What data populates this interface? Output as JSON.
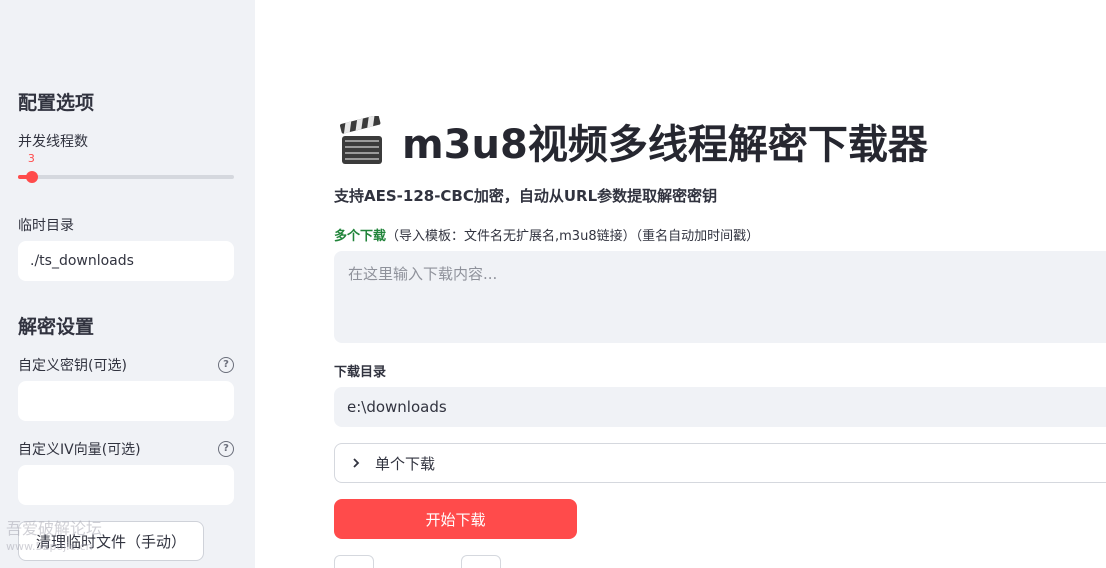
{
  "sidebar": {
    "config_heading": "配置选项",
    "threads_label": "并发线程数",
    "threads_value": "3",
    "threads_min": 1,
    "threads_max": 32,
    "tempdir_label": "临时目录",
    "tempdir_value": "./ts_downloads",
    "decrypt_heading": "解密设置",
    "key_label": "自定义密钥(可选)",
    "key_value": "",
    "iv_label": "自定义IV向量(可选)",
    "iv_value": "",
    "help_glyph": "?",
    "clean_button": "清理临时文件（手动）",
    "watermark_line1": "吾爱破解论坛",
    "watermark_line2": "www.52pojie.cn"
  },
  "main": {
    "title": "m3u8视频多线程解密下载器",
    "title_icon": "clapper-board-icon",
    "subtitle": "支持AES-128-CBC加密，自动从URL参数提取解密密钥",
    "multi_label_strong": "多个下载",
    "multi_label_rest": "（导入模板：文件名无扩展名,m3u8链接）（重名自动加时间戳）",
    "multi_placeholder": "在这里输入下载内容...",
    "download_dir_label": "下载目录",
    "download_dir_value": "e:\\downloads",
    "single_expander": "单个下载",
    "start_button": "开始下载"
  },
  "colors": {
    "accent": "#ff4b4b",
    "sidebar_bg": "#f0f2f6",
    "green_label": "#21843a"
  }
}
